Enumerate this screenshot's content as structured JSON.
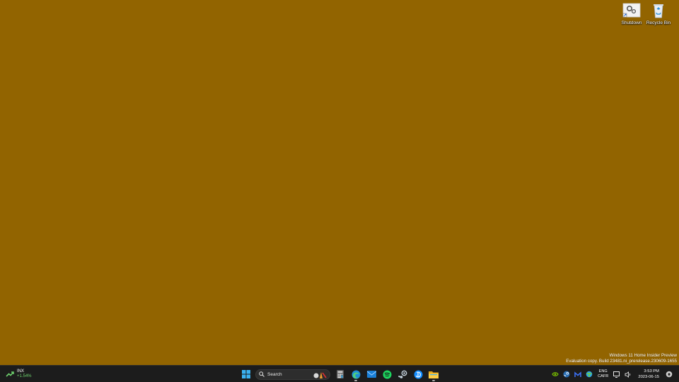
{
  "desktop": {
    "background_color": "#926400",
    "icons": [
      {
        "label": "Shutdown",
        "icon": "shutdown-shortcut-icon"
      },
      {
        "label": "Recycle Bin",
        "icon": "recycle-bin-icon"
      }
    ]
  },
  "watermark": {
    "line1": "Windows 11 Home Insider Preview",
    "line2": "Evaluation copy. Build 23481.ni_prerelease.230609-1655"
  },
  "taskbar": {
    "widget": {
      "name": "INX",
      "change": "+1.54%",
      "icon": "stock-up-icon"
    },
    "search": {
      "placeholder": "Search"
    },
    "apps": [
      {
        "name": "Start",
        "icon": "windows-start-icon"
      },
      {
        "name": "Calculator",
        "icon": "calculator-icon"
      },
      {
        "name": "Microsoft Edge",
        "icon": "edge-icon",
        "running": true
      },
      {
        "name": "Mail",
        "icon": "mail-icon"
      },
      {
        "name": "Spotify",
        "icon": "spotify-icon"
      },
      {
        "name": "Steam",
        "icon": "steam-icon"
      },
      {
        "name": "Battle.net",
        "icon": "battlenet-icon"
      },
      {
        "name": "File Explorer",
        "icon": "file-explorer-icon",
        "running": true
      }
    ],
    "tray": {
      "lang_line1": "ENG",
      "lang_line2": "CAFR",
      "time": "3:53 PM",
      "date": "2023-06-15"
    }
  },
  "colors": {
    "taskbar": "#1c1c1c",
    "accent_green": "#6fd36f",
    "windows_blue": "#3ab0f0"
  }
}
